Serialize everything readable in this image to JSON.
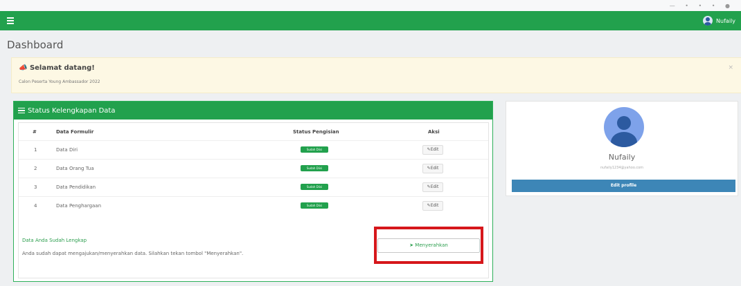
{
  "window": {
    "controls": "— • • • ●"
  },
  "navbar": {
    "user_name": "Nufaily"
  },
  "page": {
    "title": "Dashboard"
  },
  "alert": {
    "title": "Selamat datang!",
    "subtitle": "Calon Peserta Young Ambassador 2022",
    "close": "×"
  },
  "status_card": {
    "title": "Status Kelengkapan Data",
    "columns": {
      "no": "#",
      "name": "Data Formulir",
      "status": "Status Pengisian",
      "action": "Aksi"
    },
    "rows": [
      {
        "no": "1",
        "name": "Data Diri",
        "badge": "Sudah Diisi",
        "action": "Edit"
      },
      {
        "no": "2",
        "name": "Data Orang Tua",
        "badge": "Sudah Diisi",
        "action": "Edit"
      },
      {
        "no": "3",
        "name": "Data Pendidikan",
        "badge": "Sudah Diisi",
        "action": "Edit"
      },
      {
        "no": "4",
        "name": "Data Penghargaan",
        "badge": "Sudah Diisi",
        "action": "Edit"
      }
    ],
    "complete_text": "Data Anda Sudah Lengkap",
    "hint_text": "Anda sudah dapat mengajukan/menyerahkan data. Silahkan tekan tombol \"Menyerahkan\".",
    "submit_label": "Menyerahkan"
  },
  "profile": {
    "name": "Nufaily",
    "email": "nufaily1234@yahoo.com",
    "button": "Edit profile"
  },
  "colors": {
    "primary": "#22a14d",
    "accent_blue": "#3d86b7",
    "highlight_red": "#d6171b",
    "alert_bg": "#fdf8e4"
  }
}
